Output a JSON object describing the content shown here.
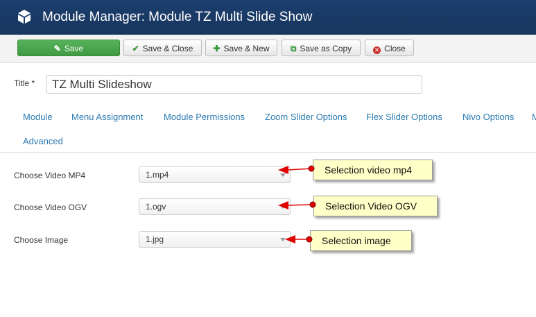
{
  "header": {
    "title": "Module Manager: Module TZ Multi Slide Show",
    "icon": "cube-icon"
  },
  "toolbar": {
    "save_label": "Save",
    "save_close_label": "Save & Close",
    "save_new_label": "Save & New",
    "save_copy_label": "Save as Copy",
    "close_label": "Close"
  },
  "title_field": {
    "label": "Title *",
    "value": "TZ Multi Slideshow"
  },
  "tabs": [
    {
      "label": "Module"
    },
    {
      "label": "Menu Assignment"
    },
    {
      "label": "Module Permissions"
    },
    {
      "label": "Zoom Slider Options"
    },
    {
      "label": "Flex Slider Options"
    },
    {
      "label": "Nivo Options"
    },
    {
      "label": "M"
    },
    {
      "label": "Advanced"
    }
  ],
  "fields": [
    {
      "label": "Choose Video MP4",
      "value": "1.mp4"
    },
    {
      "label": "Choose Video OGV",
      "value": "1.ogv"
    },
    {
      "label": "Choose Image",
      "value": "1.jpg"
    }
  ],
  "annotations": [
    {
      "text": "Selection video mp4"
    },
    {
      "text": "Selection Video OGV"
    },
    {
      "text": "Selection image"
    }
  ],
  "colors": {
    "header_bg": "#17365f",
    "save_green": "#46a546",
    "link_blue": "#2a7ab0",
    "callout_bg": "#ffffc8",
    "arrow_red": "#e00000"
  }
}
